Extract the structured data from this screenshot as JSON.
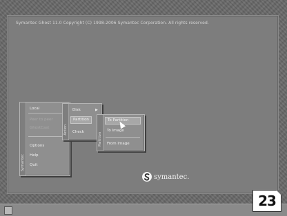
{
  "screen": {
    "title": "Symantec Ghost 11.0  Copyright (C) 1998-2006 Symantec Corporation. All rights reserved."
  },
  "menus": {
    "main": {
      "rail_label": "Symantec",
      "items": [
        "Local",
        "Peer to peer",
        "GhostCast",
        "Options",
        "Help",
        "Quit"
      ]
    },
    "action": {
      "rail_label": "Action",
      "items": [
        "Disk",
        "Partition",
        "Check"
      ]
    },
    "partition": {
      "rail_label": "Partition",
      "items": [
        "To Partition",
        "To Image",
        "From Image"
      ]
    }
  },
  "logo": {
    "text": "symantec."
  },
  "badge": {
    "number": "23"
  }
}
